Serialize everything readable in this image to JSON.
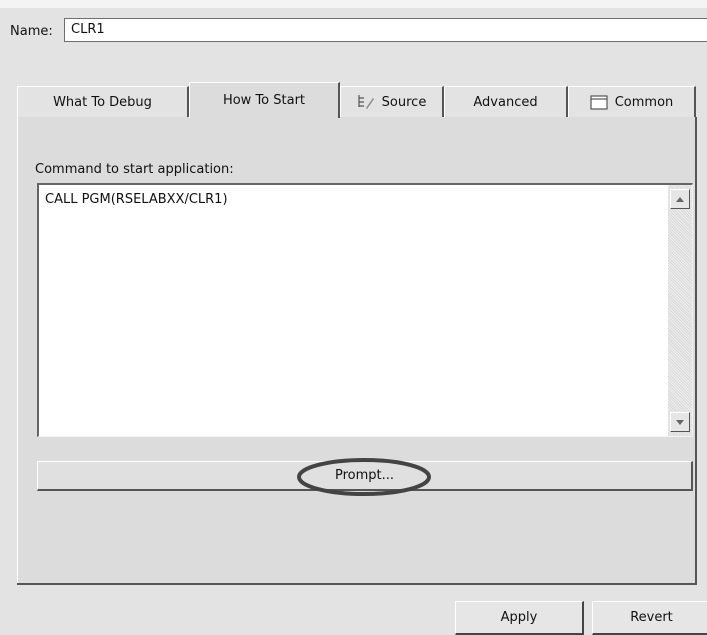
{
  "name": {
    "label": "Name:",
    "value": "CLR1"
  },
  "tabs": [
    {
      "label": "What To Debug",
      "icon": "none"
    },
    {
      "label": "How To Start",
      "icon": "none",
      "active": true
    },
    {
      "label": "Source",
      "icon": "source-tree-icon"
    },
    {
      "label": "Advanced",
      "icon": "none"
    },
    {
      "label": "Common",
      "icon": "common-window-icon"
    }
  ],
  "how_to_start": {
    "command_label": "Command to start application:",
    "command_value": "CALL PGM(RSELABXX/CLR1)",
    "prompt_label": "Prompt..."
  },
  "buttons": {
    "apply_label": "Apply",
    "revert_label": "Revert"
  }
}
